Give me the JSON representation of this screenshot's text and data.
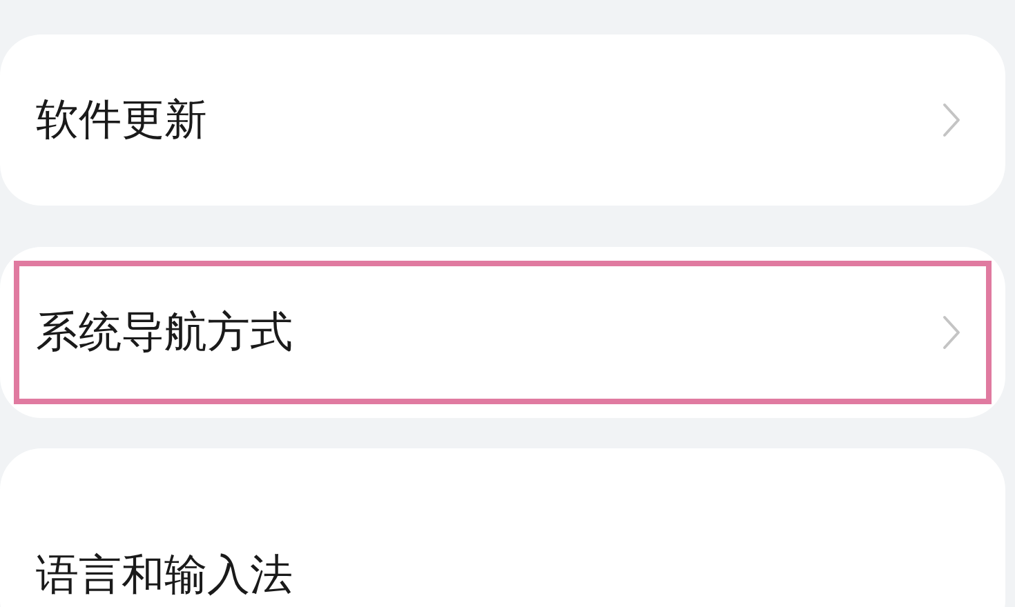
{
  "settings_items": [
    {
      "label": "软件更新",
      "selected": false
    },
    {
      "label": "系统导航方式",
      "selected": true
    },
    {
      "label": "语言和输入法",
      "selected": false
    }
  ]
}
